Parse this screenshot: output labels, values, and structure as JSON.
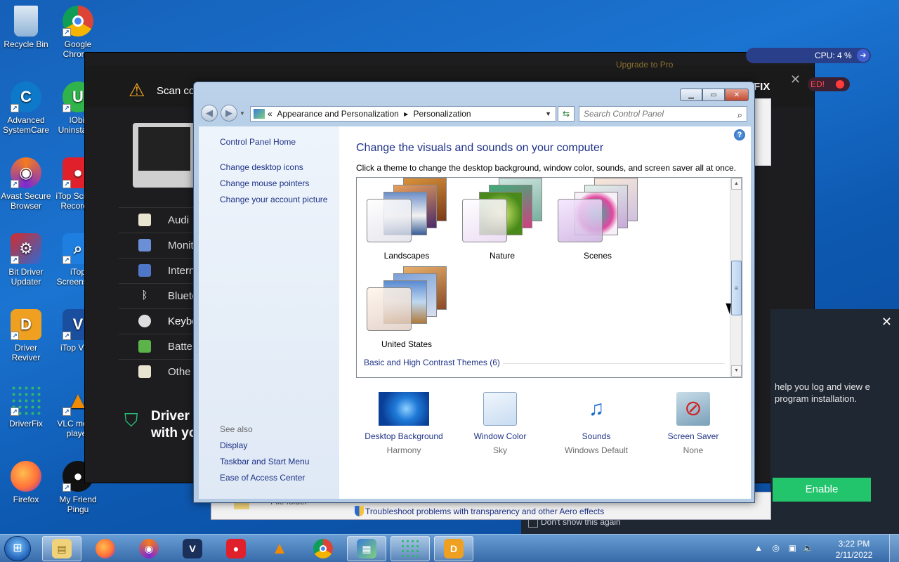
{
  "desktop": {
    "icons": [
      {
        "label": "Recycle Bin",
        "icon": "recycle-bin-icon",
        "color": "#6fa8dc"
      },
      {
        "label": "Google Chrome",
        "icon": "chrome-icon",
        "color": "#db4437"
      },
      {
        "label": "Advanced SystemCare",
        "icon": "advanced-systemcare-icon",
        "color": "#1a8fd8"
      },
      {
        "label": "IObit Uninstaller",
        "icon": "iobit-uninstaller-icon",
        "color": "#2fb34a"
      },
      {
        "label": "Avast Secure Browser",
        "icon": "avast-browser-icon",
        "color": "#f47b20"
      },
      {
        "label": "iTop Screen Recorder",
        "icon": "itop-recorder-icon",
        "color": "#e0202a"
      },
      {
        "label": "Bit Driver Updater",
        "icon": "bit-driver-updater-icon",
        "color": "#d42b2b"
      },
      {
        "label": "iTop Screenshot",
        "icon": "itop-screenshot-icon",
        "color": "#1f7fe0"
      },
      {
        "label": "Driver Reviver",
        "icon": "driver-reviver-icon",
        "color": "#f0a020"
      },
      {
        "label": "iTop VPN",
        "icon": "itop-vpn-icon",
        "color": "#1f8be0"
      },
      {
        "label": "DriverFix",
        "icon": "driverfix-icon",
        "color": "#2eb86b"
      },
      {
        "label": "VLC media player",
        "icon": "vlc-icon",
        "color": "#f08a00"
      },
      {
        "label": "Firefox",
        "icon": "firefox-icon",
        "color": "#ff7139"
      },
      {
        "label": "My Friend Pingu",
        "icon": "pingu-icon",
        "color": "#111111"
      }
    ]
  },
  "driverfix": {
    "scan_text": "Scan co",
    "fix_label": "FIX",
    "upgrade_text": "Upgrade to Pro",
    "categories": [
      "Audi",
      "Monit",
      "Intern",
      "Blueto",
      "Keybo",
      "Batte",
      "Othe"
    ],
    "promo_line1": "Driver",
    "promo_line2": "with yo"
  },
  "overlay": {
    "cpu": "CPU: 4 %",
    "status": "ED!",
    "promo_text": "help you log and view e program installation.",
    "enable_label": "Enable",
    "dont_show": "Don't show this again",
    "file_folder": "File folder"
  },
  "cp": {
    "breadcrumb": [
      "«",
      "Appearance and Personalization",
      "▸",
      "Personalization"
    ],
    "search_placeholder": "Search Control Panel",
    "left_links": [
      "Control Panel Home",
      "Change desktop icons",
      "Change mouse pointers",
      "Change your account picture"
    ],
    "see_also_label": "See also",
    "see_also": [
      "Display",
      "Taskbar and Start Menu",
      "Ease of Access Center"
    ],
    "title": "Change the visuals and sounds on your computer",
    "subtitle": "Click a theme to change the desktop background, window color, sounds, and screen saver all at once.",
    "themes": [
      "Landscapes",
      "Nature",
      "Scenes",
      "United States"
    ],
    "basic_high_contrast": "Basic and High Contrast Themes (6)",
    "bottom": [
      {
        "label": "Desktop Background",
        "value": "Harmony"
      },
      {
        "label": "Window Color",
        "value": "Sky"
      },
      {
        "label": "Sounds",
        "value": "Windows Default"
      },
      {
        "label": "Screen Saver",
        "value": "None"
      }
    ],
    "troubleshoot": "Troubleshoot problems with transparency and other Aero effects"
  },
  "taskbar": {
    "time": "3:22 PM",
    "date": "2/11/2022"
  }
}
